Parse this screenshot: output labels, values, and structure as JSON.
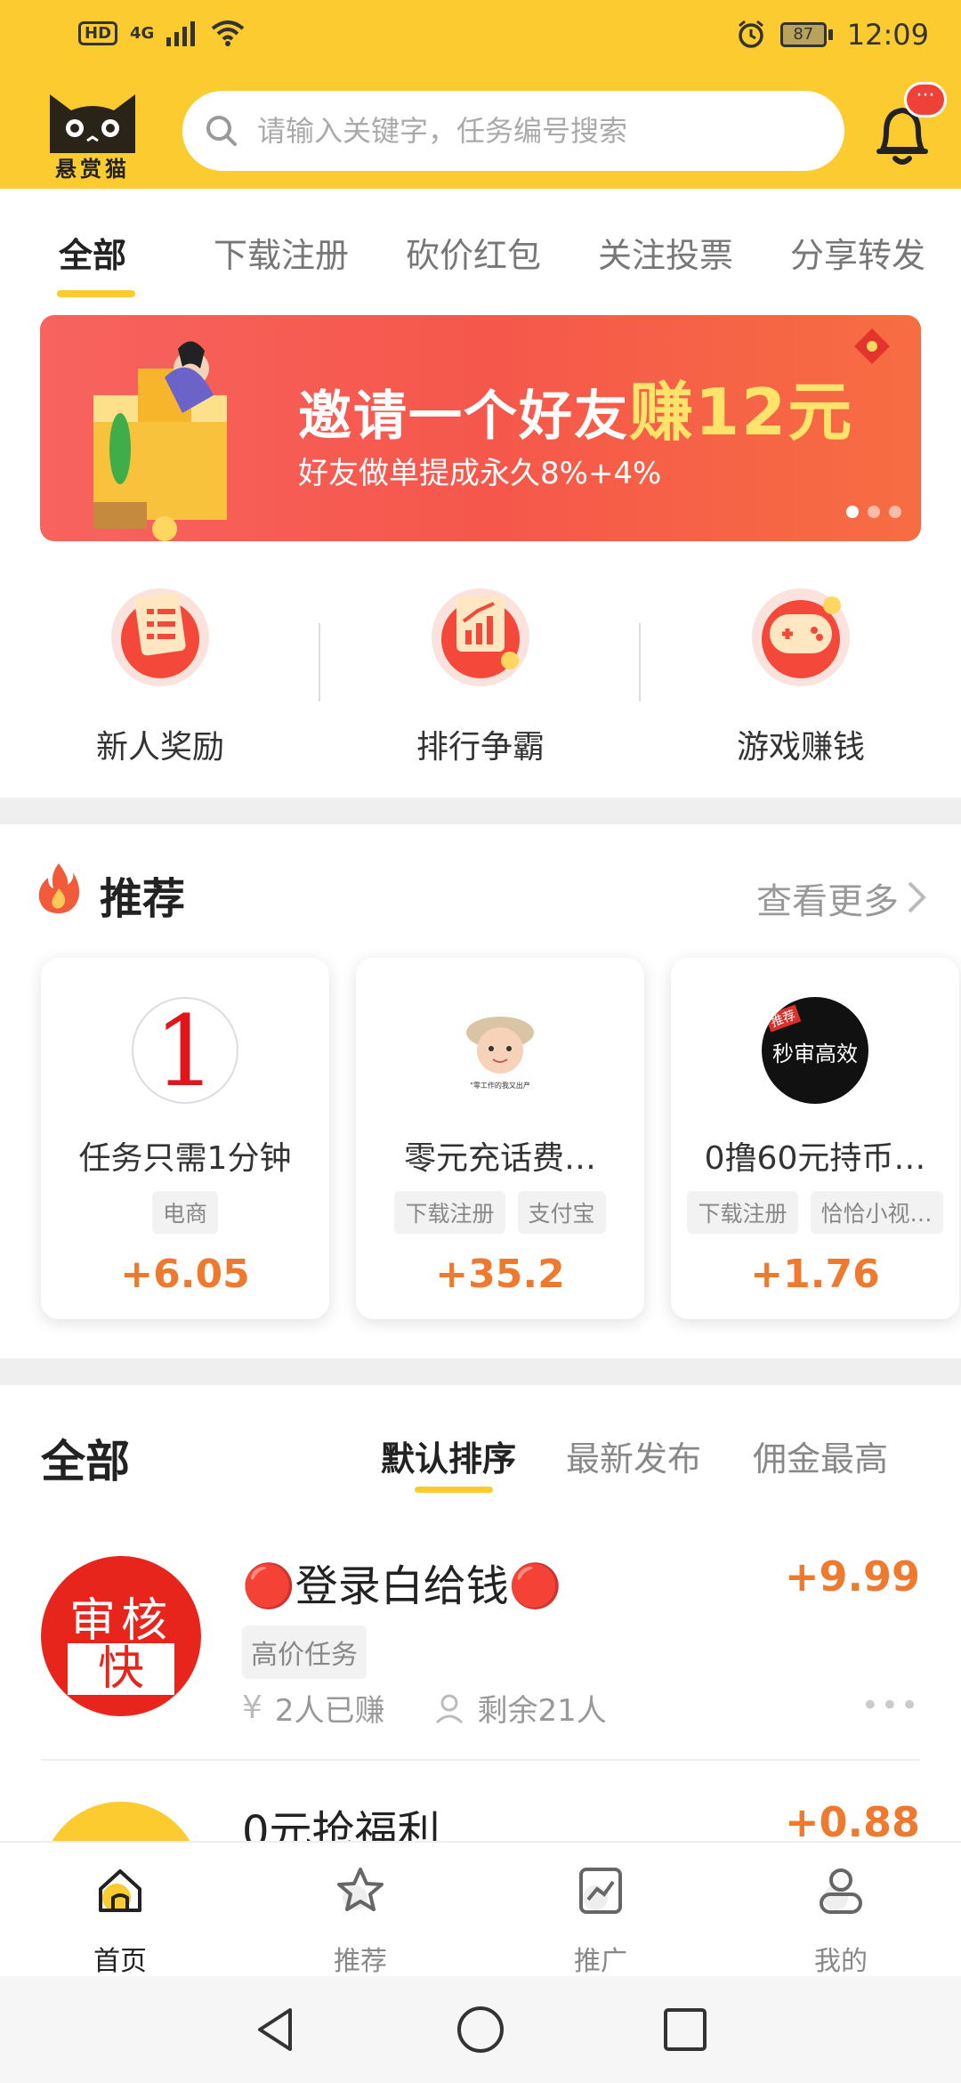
{
  "status_bar": {
    "network": "4G",
    "hd": "HD",
    "battery": "87",
    "time": "12:09"
  },
  "header": {
    "logo_text": "悬赏猫",
    "search_placeholder": "请输入关键字，任务编号搜索",
    "notification_badge": "···"
  },
  "categories": [
    "全部",
    "下载注册",
    "砍价红包",
    "关注投票",
    "分享转发"
  ],
  "banner": {
    "title_prefix": "邀请一个好友",
    "title_highlight": "赚12元",
    "subtitle": "好友做单提成永久8%+4%"
  },
  "quick_entries": [
    {
      "label": "新人奖励",
      "icon": "document-icon"
    },
    {
      "label": "排行争霸",
      "icon": "chart-icon"
    },
    {
      "label": "游戏赚钱",
      "icon": "gamepad-icon"
    }
  ],
  "recommend": {
    "title": "推荐",
    "more": "查看更多",
    "cards": [
      {
        "name": "任务只需1分钟",
        "tags": [
          "电商"
        ],
        "price": "+6.05",
        "avatar_text": "1",
        "avatar_caption": ""
      },
      {
        "name": "零元充话费…",
        "tags": [
          "下载注册",
          "支付宝"
        ],
        "price": "+35.2",
        "avatar_text": "",
        "avatar_caption": "\"零工作的我又出产"
      },
      {
        "name": "0撸60元持币…",
        "tags": [
          "下载注册",
          "恰恰小视…"
        ],
        "price": "+1.76",
        "avatar_text": "秒审高效",
        "avatar_caption": "推荐"
      }
    ]
  },
  "all_section": {
    "title": "全部",
    "sorts": [
      "默认排序",
      "最新发布",
      "佣金最高"
    ],
    "items": [
      {
        "title": "🔴登录白给钱🔴",
        "price": "+9.99",
        "tag": "高价任务",
        "earned": "2人已赚",
        "remaining": "剩余21人",
        "thumb_top": "审核",
        "thumb_bottom": "快"
      },
      {
        "title": "0元抢福利",
        "price": "+0.88",
        "tag": "",
        "earned": "",
        "remaining": "",
        "thumb_top": "",
        "thumb_bottom": ""
      }
    ]
  },
  "bottom_nav": [
    {
      "label": "首页",
      "icon": "home-icon",
      "active": true
    },
    {
      "label": "推荐",
      "icon": "star-icon",
      "active": false
    },
    {
      "label": "推广",
      "icon": "trend-icon",
      "active": false
    },
    {
      "label": "我的",
      "icon": "user-icon",
      "active": false
    }
  ],
  "colors": {
    "brand_yellow": "#FBCB2F",
    "price_orange": "#EE7A30",
    "banner_red": "#F5574B"
  }
}
